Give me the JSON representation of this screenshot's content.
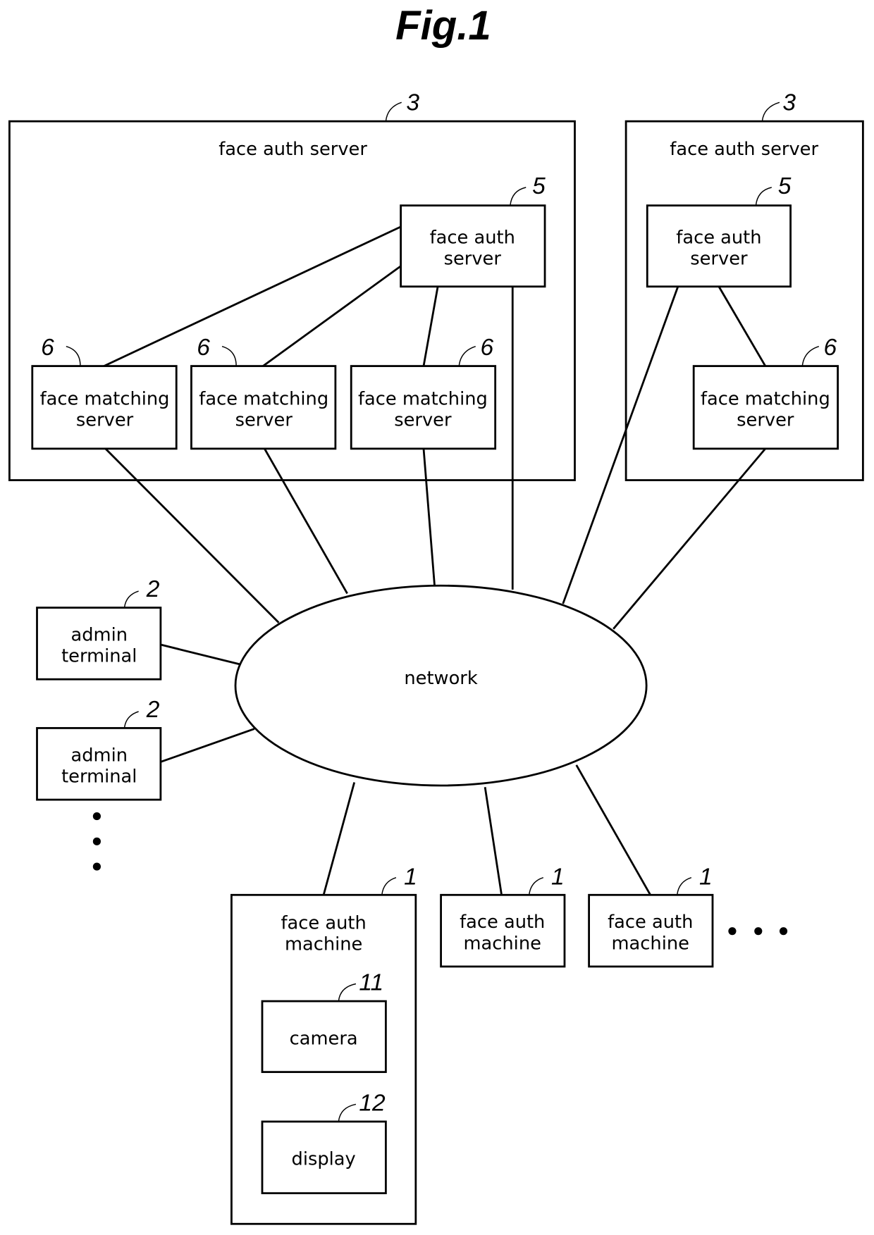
{
  "figure": {
    "title": "Fig.1",
    "colors": {
      "ink": "#000000",
      "background": "#ffffff"
    }
  },
  "groups": [
    {
      "id": "auth-server-group-left",
      "ref": "3",
      "label": "face auth server"
    },
    {
      "id": "auth-server-group-right",
      "ref": "3",
      "label": "face auth server"
    }
  ],
  "nodes": {
    "auth_server_left": {
      "ref": "5",
      "lines": [
        "face auth",
        "server"
      ]
    },
    "auth_server_right": {
      "ref": "5",
      "lines": [
        "face auth",
        "server"
      ]
    },
    "matching_1": {
      "ref": "6",
      "lines": [
        "face matching",
        "server"
      ]
    },
    "matching_2": {
      "ref": "6",
      "lines": [
        "face matching",
        "server"
      ]
    },
    "matching_3": {
      "ref": "6",
      "lines": [
        "face matching",
        "server"
      ]
    },
    "matching_right": {
      "ref": "6",
      "lines": [
        "face matching",
        "server"
      ]
    },
    "admin_1": {
      "ref": "2",
      "lines": [
        "admin",
        "terminal"
      ]
    },
    "admin_2": {
      "ref": "2",
      "lines": [
        "admin",
        "terminal"
      ]
    },
    "network": {
      "label": "network"
    },
    "machine_main": {
      "ref": "1",
      "lines": [
        "face auth",
        "machine"
      ]
    },
    "machine_2": {
      "ref": "1",
      "lines": [
        "face auth",
        "machine"
      ]
    },
    "machine_3": {
      "ref": "1",
      "lines": [
        "face auth",
        "machine"
      ]
    },
    "camera": {
      "ref": "11",
      "label": "camera"
    },
    "display": {
      "ref": "12",
      "label": "display"
    }
  },
  "ellipsis": {
    "admin_terminals": "vertical-dots",
    "machines": "horizontal-dots"
  }
}
